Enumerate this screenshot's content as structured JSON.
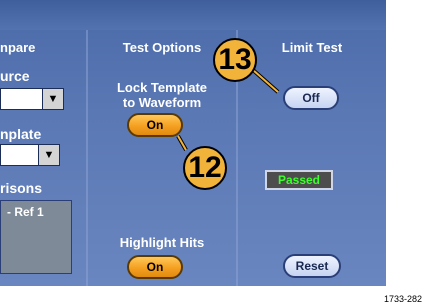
{
  "columns": {
    "compare_partial": "npare",
    "test_options": "Test Options",
    "limit_test": "Limit Test"
  },
  "left": {
    "source_label": "urce",
    "template_label": "nplate",
    "comparisons_label": "risons",
    "ref_item": "- Ref 1"
  },
  "test_options": {
    "lock_template_line1": "Lock Template",
    "lock_template_line2": "to Waveform",
    "lock_button": "On",
    "highlight_label": "Highlight Hits",
    "highlight_button": "On"
  },
  "limit_test": {
    "toggle_button": "Off",
    "status": "Passed",
    "reset_button": "Reset"
  },
  "callouts": {
    "a": "13",
    "b": "12"
  },
  "figure_number": "1733-282",
  "colors": {
    "panel": "#5a78b4",
    "button_orange": "#f5a020",
    "status_green": "#3cff2c"
  }
}
